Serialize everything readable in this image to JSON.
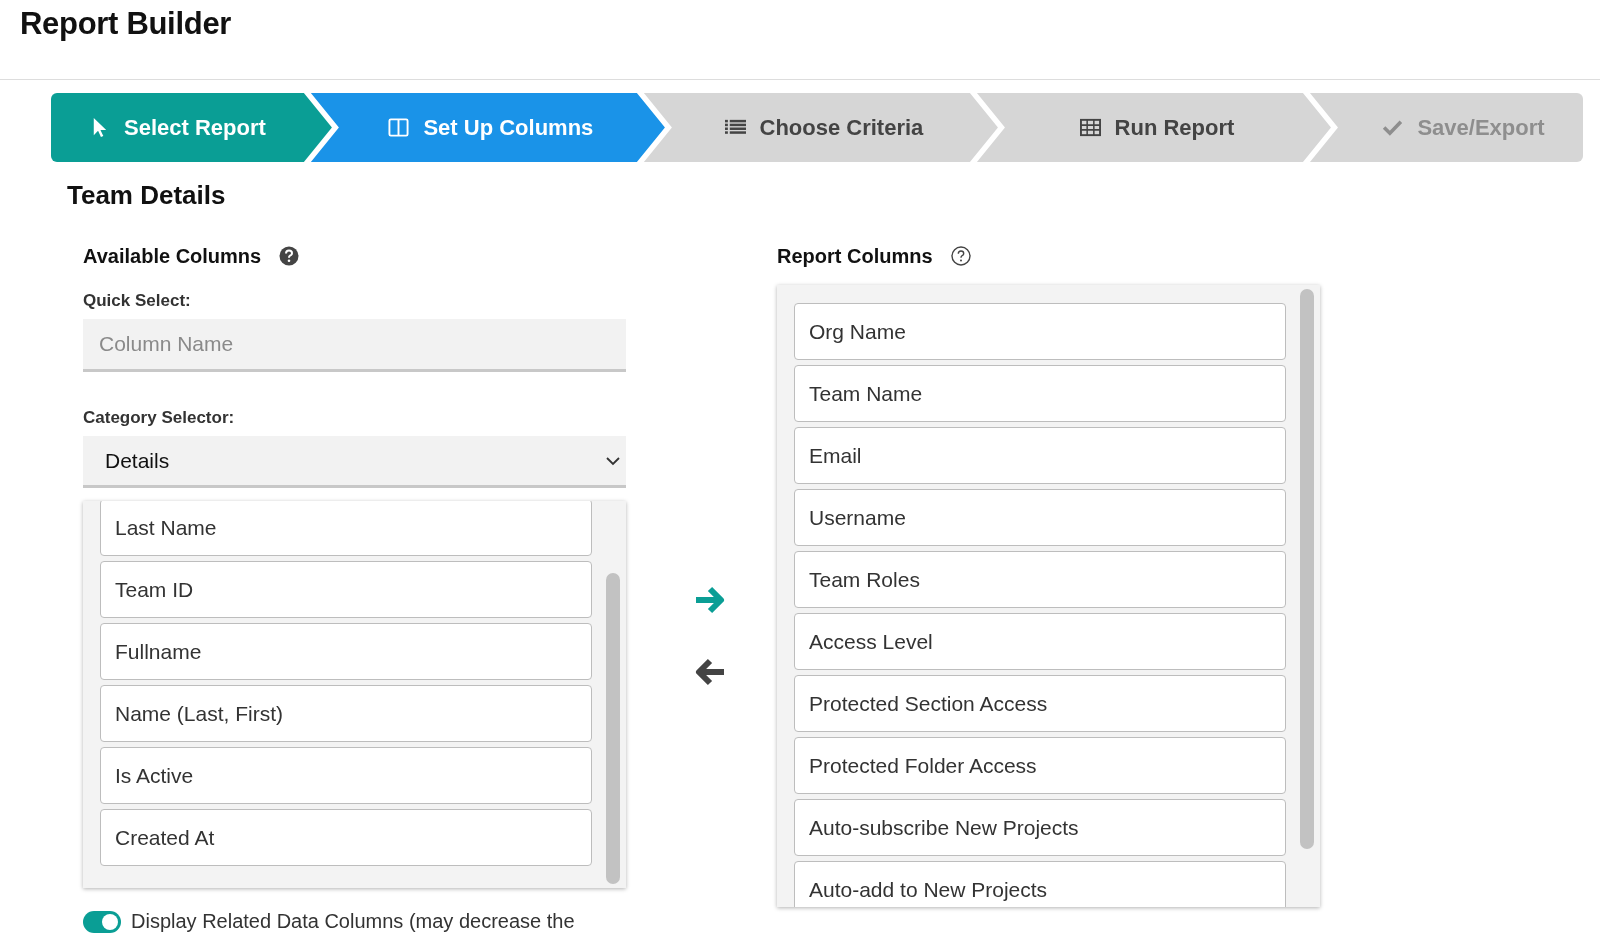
{
  "page_title": "Report Builder",
  "steps": [
    {
      "label": "Select Report",
      "completed": true,
      "selected": false,
      "disabled": false
    },
    {
      "label": "Set Up Columns",
      "completed": false,
      "selected": true,
      "disabled": false
    },
    {
      "label": "Choose Criteria",
      "completed": false,
      "selected": false,
      "disabled": false
    },
    {
      "label": "Run Report",
      "completed": false,
      "selected": false,
      "disabled": false
    },
    {
      "label": "Save/Export",
      "completed": false,
      "selected": false,
      "disabled": true
    }
  ],
  "section_title": "Team Details",
  "available": {
    "title": "Available Columns",
    "quick_select_label": "Quick Select:",
    "quick_select_placeholder": "Column Name",
    "category_label": "Category Selector:",
    "category_value": "Details",
    "items": [
      "Last Name",
      "Team ID",
      "Fullname",
      "Name (Last, First)",
      "Is Active",
      "Created At"
    ]
  },
  "related_toggle": {
    "on": true,
    "label": "Display Related Data Columns (may decrease the"
  },
  "report": {
    "title": "Report Columns",
    "items": [
      "Org Name",
      "Team Name",
      "Email",
      "Username",
      "Team Roles",
      "Access Level",
      "Protected Section Access",
      "Protected Folder Access",
      "Auto-subscribe New Projects",
      "Auto-add to New Projects"
    ]
  }
}
